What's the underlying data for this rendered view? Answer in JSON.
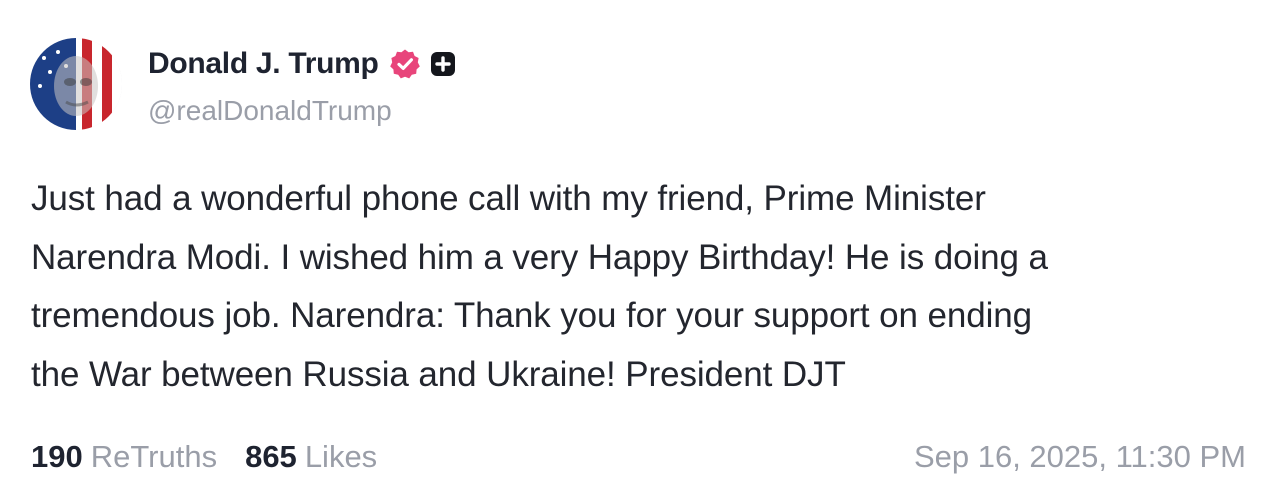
{
  "author": {
    "display_name": "Donald J. Trump",
    "handle": "@realDonaldTrump",
    "verified_icon": "verified-check-icon",
    "badge_icon": "plus-badge-icon",
    "verified_color": "#e8457b"
  },
  "post": {
    "text": "Just had a wonderful phone call with my friend, Prime Minister\nNarendra Modi. I wished him a very Happy Birthday! He is doing a\ntremendous job. Narendra: Thank you for your support on ending\nthe War between Russia and Ukraine! President DJT"
  },
  "stats": {
    "retruths_count": "190",
    "retruths_label": "ReTruths",
    "likes_count": "865",
    "likes_label": "Likes"
  },
  "timestamp": "Sep 16, 2025, 11:30 PM"
}
